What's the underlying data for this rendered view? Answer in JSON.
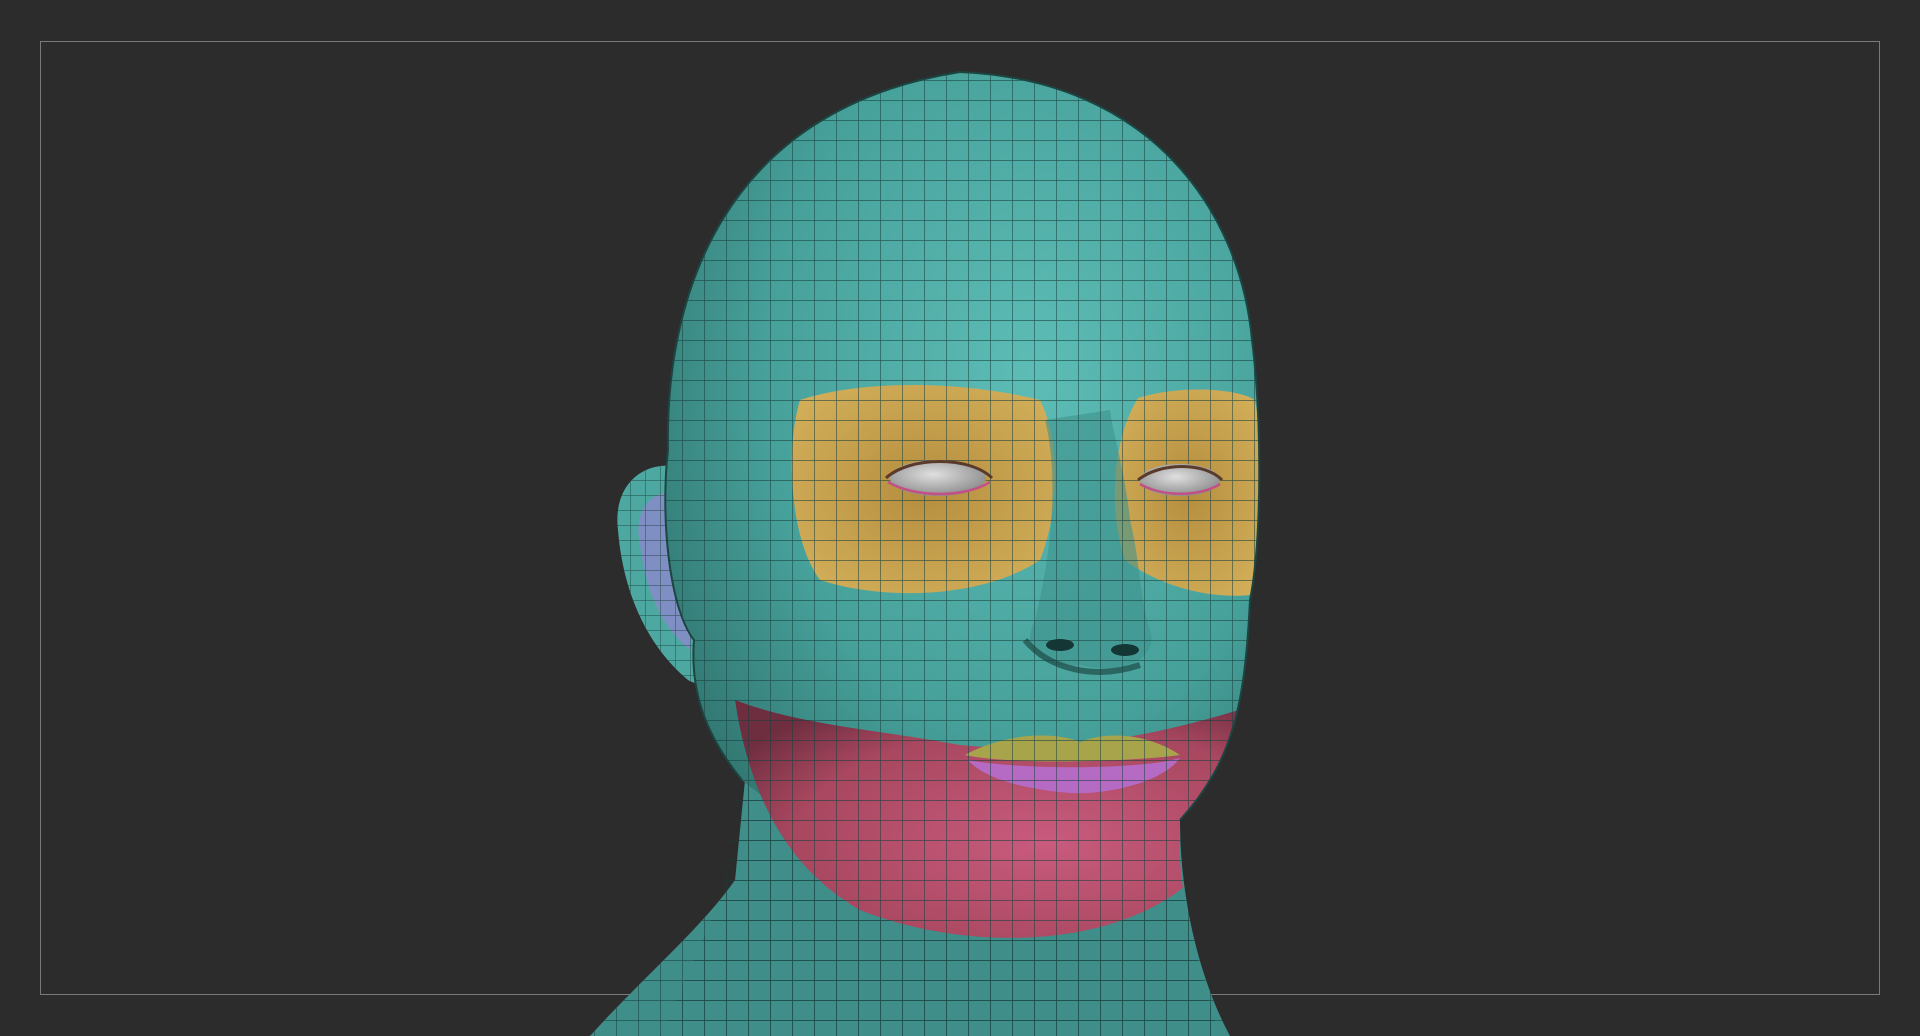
{
  "viewport": {
    "background_color": "#2c2c2c",
    "frame_color": "#7a7a7a"
  },
  "model": {
    "subject": "head mesh",
    "wireframe_color": "#173f3c",
    "polygroups": [
      {
        "name": "head",
        "color": "#4ea8a2"
      },
      {
        "name": "eye-sockets",
        "color": "#c9a451"
      },
      {
        "name": "jaw-chin",
        "color": "#b8506f"
      },
      {
        "name": "upper-lip",
        "color": "#a8a44c"
      },
      {
        "name": "lower-lip",
        "color": "#b56ac4"
      },
      {
        "name": "ear-inner",
        "color": "#7f8fc4"
      },
      {
        "name": "eyeballs",
        "color": "#bdbdbd"
      }
    ]
  }
}
